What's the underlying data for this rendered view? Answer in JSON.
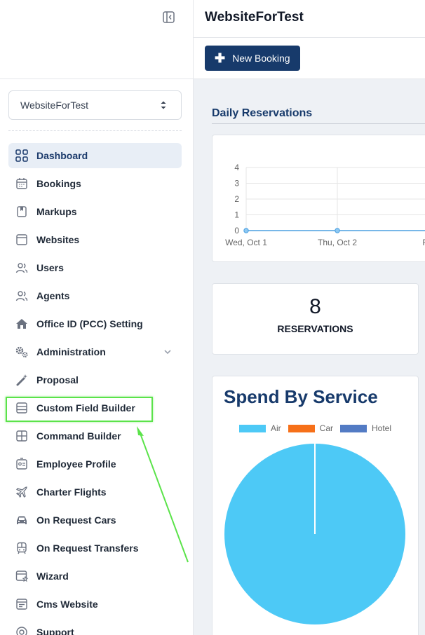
{
  "sidebar": {
    "site_selector": {
      "value": "WebsiteForTest"
    },
    "items": [
      {
        "label": "Dashboard",
        "icon": "dashboard-grid-icon",
        "active": true
      },
      {
        "label": "Bookings",
        "icon": "calendar-icon"
      },
      {
        "label": "Markups",
        "icon": "bookmark-icon"
      },
      {
        "label": "Websites",
        "icon": "browser-window-icon"
      },
      {
        "label": "Users",
        "icon": "users-icon"
      },
      {
        "label": "Agents",
        "icon": "agents-icon"
      },
      {
        "label": "Office ID (PCC) Setting",
        "icon": "home-icon"
      },
      {
        "label": "Administration",
        "icon": "gears-icon"
      },
      {
        "label": "Proposal",
        "icon": "magic-wand-icon"
      },
      {
        "label": "Custom Field Builder",
        "icon": "form-rows-icon"
      },
      {
        "label": "Command Builder",
        "icon": "layout-panels-icon"
      },
      {
        "label": "Employee Profile",
        "icon": "id-card-icon"
      },
      {
        "label": "Charter Flights",
        "icon": "airplane-icon"
      },
      {
        "label": "On Request Cars",
        "icon": "car-icon"
      },
      {
        "label": "On Request Transfers",
        "icon": "bus-icon"
      },
      {
        "label": "Wizard",
        "icon": "wizard-window-icon"
      },
      {
        "label": "Cms Website",
        "icon": "cms-icon"
      },
      {
        "label": "Support",
        "icon": "support-icon"
      }
    ]
  },
  "header": {
    "title": "WebsiteForTest"
  },
  "toolbar": {
    "new_booking_label": "New Booking"
  },
  "main": {
    "daily_title": "Daily Reservations",
    "reservations": {
      "count": "8",
      "label": "RESERVATIONS"
    },
    "spend_title": "Spend By Service"
  },
  "colors": {
    "brand": "#173a6b",
    "air": "#4dc9f6",
    "car": "#f67019",
    "hotel": "#537bc4",
    "highlight": "#5be34a"
  },
  "chart_data": [
    {
      "type": "line",
      "x": [
        "Wed, Oct 1",
        "Thu, Oct 2",
        "Fri,"
      ],
      "series": [
        {
          "values": [
            0,
            0,
            0
          ]
        }
      ],
      "ylim": [
        0,
        4
      ],
      "yticks": [
        "0",
        "1",
        "2",
        "3",
        "4"
      ],
      "grid": true
    },
    {
      "type": "pie",
      "categories": [
        "Air",
        "Car",
        "Hotel"
      ],
      "values": [
        100,
        0,
        0
      ],
      "legend": "top"
    }
  ]
}
